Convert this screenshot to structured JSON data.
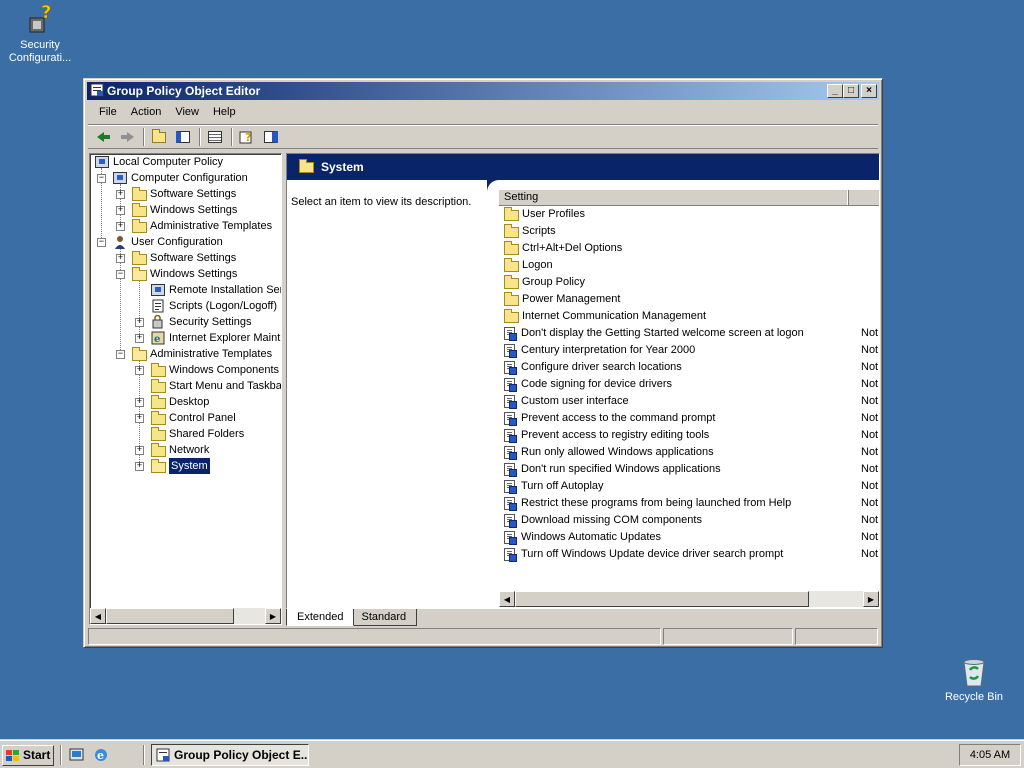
{
  "desktop": {
    "icons": [
      {
        "label_line1": "Security",
        "label_line2": "Configurati..."
      },
      {
        "label_line1": "Recycle Bin"
      }
    ]
  },
  "window": {
    "title": "Group Policy Object Editor",
    "controls": {
      "minimize": "_",
      "maximize": "□",
      "close": "×"
    },
    "menu": [
      "File",
      "Action",
      "View",
      "Help"
    ],
    "toolbar_icons": [
      "back-icon",
      "forward-icon",
      "up-folder-icon",
      "show-hide-tree-icon",
      "export-list-icon",
      "help-icon",
      "properties-icon"
    ]
  },
  "tree": {
    "items": [
      {
        "label": "Local Computer Policy"
      },
      {
        "label": "Computer Configuration"
      },
      {
        "label": "Software Settings"
      },
      {
        "label": "Windows Settings"
      },
      {
        "label": "Administrative Templates"
      },
      {
        "label": "User Configuration"
      },
      {
        "label": "Software Settings"
      },
      {
        "label": "Windows Settings"
      },
      {
        "label": "Remote Installation Ser"
      },
      {
        "label": "Scripts (Logon/Logoff)"
      },
      {
        "label": "Security Settings"
      },
      {
        "label": "Internet Explorer Maint"
      },
      {
        "label": "Administrative Templates"
      },
      {
        "label": "Windows Components"
      },
      {
        "label": "Start Menu and Taskba"
      },
      {
        "label": "Desktop"
      },
      {
        "label": "Control Panel"
      },
      {
        "label": "Shared Folders"
      },
      {
        "label": "Network"
      },
      {
        "label": "System"
      }
    ]
  },
  "details": {
    "header": "System",
    "description": "Select an item to view its description.",
    "column_setting": "Setting",
    "folders": [
      "User Profiles",
      "Scripts",
      "Ctrl+Alt+Del Options",
      "Logon",
      "Group Policy",
      "Power Management",
      "Internet Communication Management"
    ],
    "policies": [
      {
        "name": "Don't display the Getting Started welcome screen at logon",
        "state": "Not"
      },
      {
        "name": "Century interpretation for Year 2000",
        "state": "Not"
      },
      {
        "name": "Configure driver search locations",
        "state": "Not"
      },
      {
        "name": "Code signing for device drivers",
        "state": "Not"
      },
      {
        "name": "Custom user interface",
        "state": "Not"
      },
      {
        "name": "Prevent access to the command prompt",
        "state": "Not"
      },
      {
        "name": "Prevent access to registry editing tools",
        "state": "Not"
      },
      {
        "name": "Run only allowed Windows applications",
        "state": "Not"
      },
      {
        "name": "Don't run specified Windows applications",
        "state": "Not"
      },
      {
        "name": "Turn off Autoplay",
        "state": "Not"
      },
      {
        "name": "Restrict these programs from being launched from Help",
        "state": "Not"
      },
      {
        "name": "Download missing COM components",
        "state": "Not"
      },
      {
        "name": "Windows Automatic Updates",
        "state": "Not"
      },
      {
        "name": "Turn off Windows Update device driver search prompt",
        "state": "Not"
      }
    ],
    "tabs": [
      "Extended",
      "Standard"
    ]
  },
  "taskbar": {
    "start_label": "Start",
    "task_label": "Group Policy Object E...",
    "clock": "4:05 AM"
  }
}
